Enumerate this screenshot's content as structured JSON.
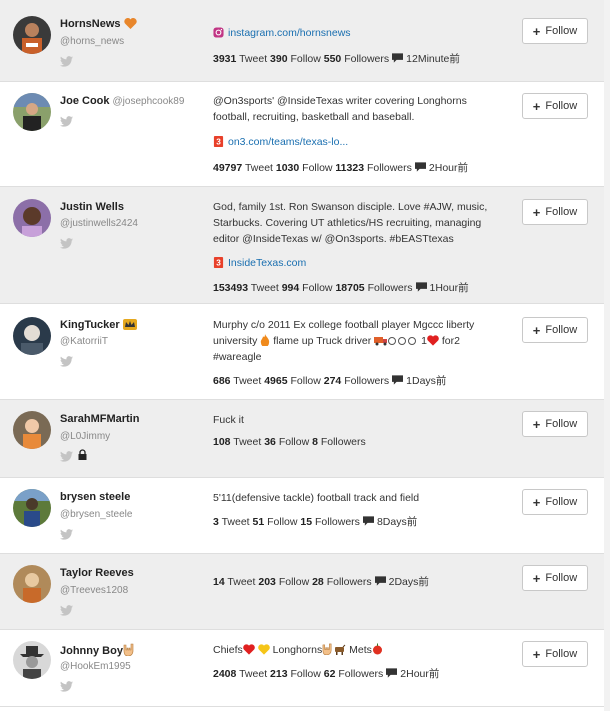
{
  "follow_label": "Follow",
  "colors": {
    "link": "#1a6fb0",
    "alt_row": "#eeeeee",
    "heart": "#e02020"
  },
  "rows": [
    {
      "name": "HornsNews",
      "handle": "@horns_news",
      "link": "instagram.com/hornsnews",
      "stats": {
        "tweets": "3931",
        "tweet_label": "Tweet",
        "follows": "390",
        "follow_label": "Follow",
        "followers": "550",
        "followers_label": "Followers",
        "time": "12Minute前"
      }
    },
    {
      "name": "Joe Cook",
      "handle": "@josephcook89",
      "bio": "@On3sports' @InsideTexas writer covering Longhorns football, recruiting, basketball and baseball.",
      "link": "on3.com/teams/texas-lo...",
      "stats": {
        "tweets": "49797",
        "tweet_label": "Tweet",
        "follows": "1030",
        "follow_label": "Follow",
        "followers": "11323",
        "followers_label": "Followers",
        "time": "2Hour前"
      }
    },
    {
      "name": "Justin Wells",
      "handle": "@justinwells2424",
      "bio": "God, family 1st. Ron Swanson disciple. Love #AJW, music, Starbucks. Covering UT athletics/HS recruiting, managing editor @InsideTexas w/ @On3sports. #bEASTtexas",
      "link": "InsideTexas.com",
      "stats": {
        "tweets": "153493",
        "tweet_label": "Tweet",
        "follows": "994",
        "follow_label": "Follow",
        "followers": "18705",
        "followers_label": "Followers",
        "time": "1Hour前"
      }
    },
    {
      "name": "KingTucker",
      "handle": "@KatorriiT",
      "bio_line1": "Murphy c/o 2011 Ex college football player Mgccc liberty",
      "bio_line2a": "university",
      "bio_line2b": "flame up Truck driver",
      "bio_line2c": "1",
      "bio_line2d": "for2",
      "bio_line3": "#wareagle",
      "stats": {
        "tweets": "686",
        "tweet_label": "Tweet",
        "follows": "4965",
        "follow_label": "Follow",
        "followers": "274",
        "followers_label": "Followers",
        "time": "1Days前"
      }
    },
    {
      "name": "SarahMFMartin",
      "handle": "@L0Jimmy",
      "bio": "Fuck it",
      "stats": {
        "tweets": "108",
        "tweet_label": "Tweet",
        "follows": "36",
        "follow_label": "Follow",
        "followers": "8",
        "followers_label": "Followers"
      }
    },
    {
      "name": "brysen steele",
      "handle": "@brysen_steele",
      "bio": "5'11(defensive tackle) football track and field",
      "stats": {
        "tweets": "3",
        "tweet_label": "Tweet",
        "follows": "51",
        "follow_label": "Follow",
        "followers": "15",
        "followers_label": "Followers",
        "time": "8Days前"
      }
    },
    {
      "name": "Taylor Reeves",
      "handle": "@Treeves1208",
      "stats": {
        "tweets": "14",
        "tweet_label": "Tweet",
        "follows": "203",
        "follow_label": "Follow",
        "followers": "28",
        "followers_label": "Followers",
        "time": "2Days前"
      }
    },
    {
      "name": "Johnny Boy",
      "handle": "@HookEm1995",
      "bio_a": "Chiefs",
      "bio_b": "Longhorns",
      "bio_c": "Mets",
      "stats": {
        "tweets": "2408",
        "tweet_label": "Tweet",
        "follows": "213",
        "follow_label": "Follow",
        "followers": "62",
        "followers_label": "Followers",
        "time": "2Hour前"
      }
    }
  ]
}
